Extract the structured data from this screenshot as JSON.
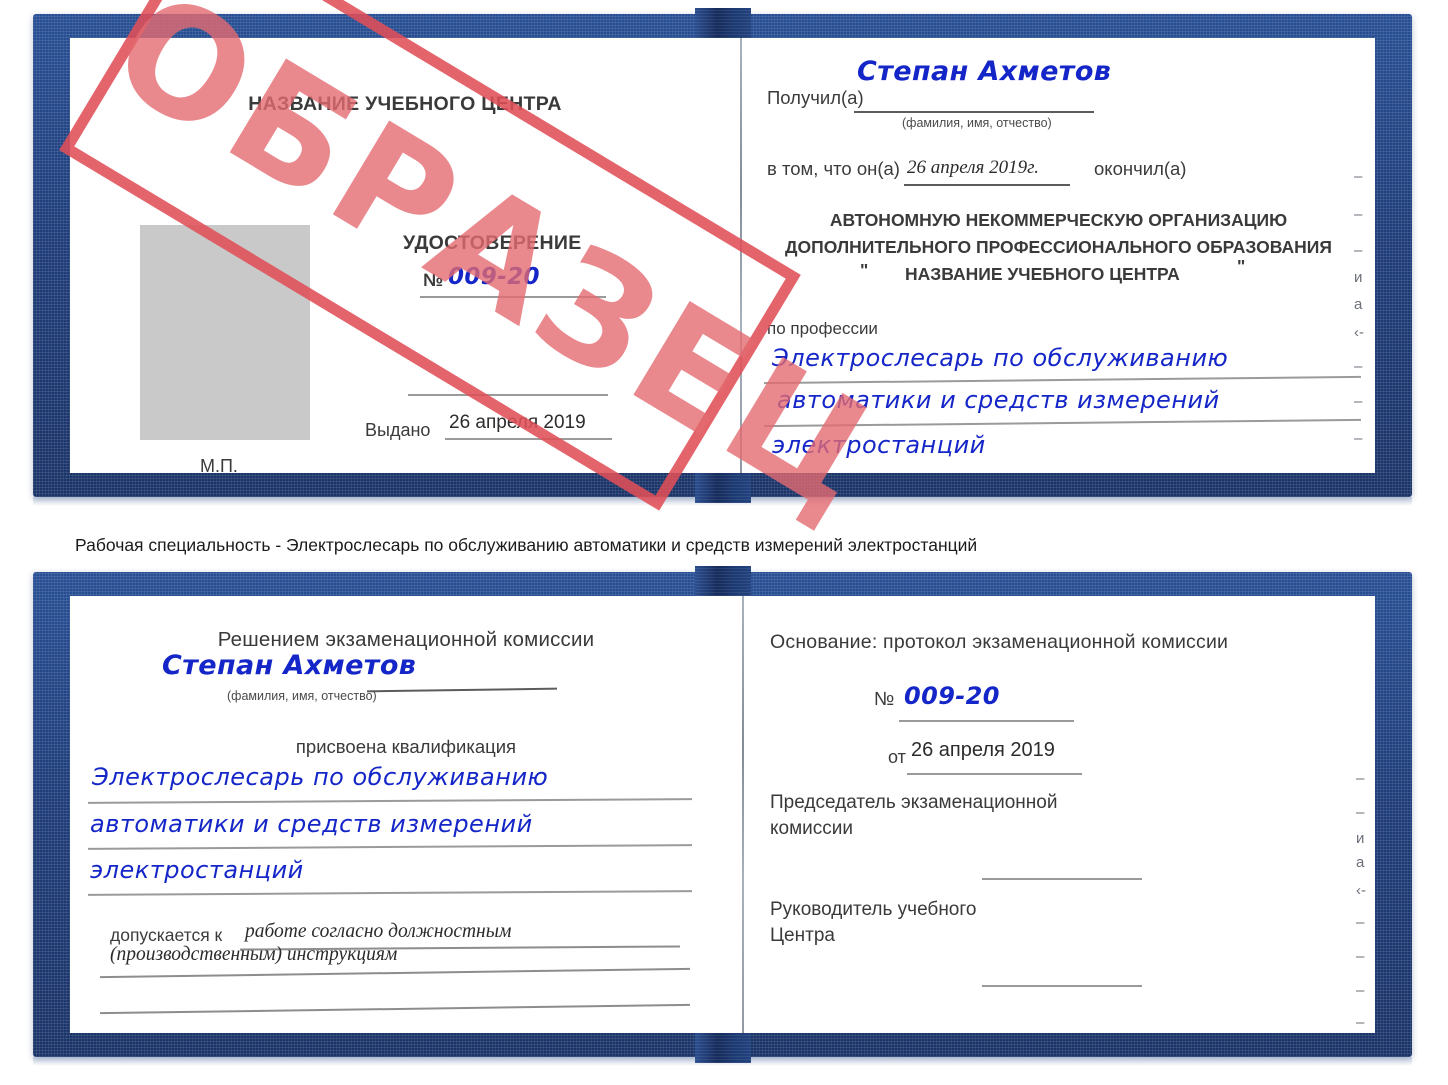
{
  "document": {
    "kind": "Удостоверение (образец)",
    "watermark": "ОБРАЗЕЦ",
    "colors": {
      "cover_blue": "#1f3d7a",
      "watermark_red": "#e04e58",
      "handwriting_blue": "#1526c8",
      "photo_placeholder_gray": "#c9c9c9",
      "rule_gray": "#9a9a9a"
    }
  },
  "caption": {
    "text": "Рабочая специальность - Электрослесарь по обслуживанию автоматики и средств измерений электростанций"
  },
  "certificate_top": {
    "left_page": {
      "center_name": "НАЗВАНИЕ УЧЕБНОГО ЦЕНТРА",
      "title": "УДОСТОВЕРЕНИЕ",
      "number_label": "№",
      "number_value": "009-20",
      "issued_label": "Выдано",
      "issued_value": "26 апреля 2019",
      "seal_label": "М.П."
    },
    "right_page": {
      "received_label": "Получил(а)",
      "received_value": "Степан Ахметов",
      "received_hint": "(фамилия, имя, отчество)",
      "in_that_label": "в том, что он(а)",
      "in_that_value": "26 апреля 2019г.",
      "finished_label": "окончил(а)",
      "org_line1": "АВТОНОМНУЮ НЕКОММЕРЧЕСКУЮ ОРГАНИЗАЦИЮ",
      "org_line2": "ДОПОЛНИТЕЛЬНОГО ПРОФЕССИОНАЛЬНОГО ОБРАЗОВАНИЯ",
      "org_quote_open": "\"",
      "org_line3": "НАЗВАНИЕ УЧЕБНОГО ЦЕНТРА",
      "org_quote_close": "\"",
      "profession_label": "по профессии",
      "profession_line1": "Электрослесарь по обслуживанию",
      "profession_line2": "автоматики и средств измерений",
      "profession_line3": "электростанций",
      "margin_marks": [
        "–",
        "–",
        "–",
        "и",
        "а",
        "‹-",
        "–",
        "–",
        "–"
      ]
    }
  },
  "certificate_bottom": {
    "left_page": {
      "decision_title": "Решением экзаменационной комиссии",
      "name_value": "Степан Ахметов",
      "name_hint": "(фамилия, имя, отчество)",
      "qualification_label": "присвоена квалификация",
      "qualification_line1": "Электрослесарь по обслуживанию",
      "qualification_line2": "автоматики и средств измерений",
      "qualification_line3": "электростанций",
      "allowed_label": "допускается к",
      "allowed_value_line1": "работе согласно должностным",
      "allowed_value_line2": "(производственным) инструкциям"
    },
    "right_page": {
      "basis_label": "Основание: протокол экзаменационной комиссии",
      "number_label": "№",
      "number_value": "009-20",
      "date_label": "от",
      "date_value": "26 апреля 2019",
      "chairman_line1": "Председатель экзаменационной",
      "chairman_line2": "комиссии",
      "head_line1": "Руководитель учебного",
      "head_line2": "Центра",
      "margin_marks": [
        "–",
        "–",
        "и",
        "а",
        "‹-",
        "–",
        "–",
        "–",
        "–"
      ]
    }
  }
}
